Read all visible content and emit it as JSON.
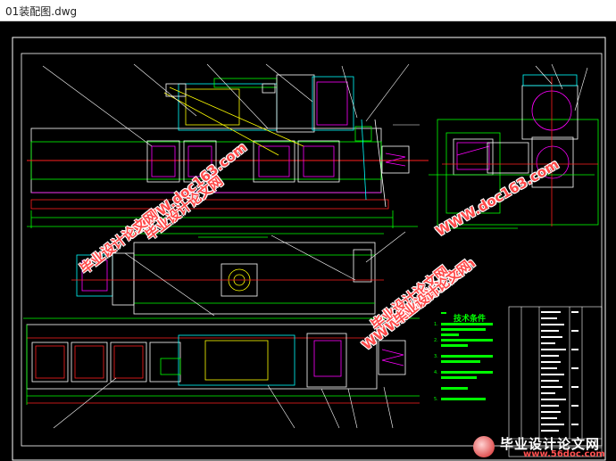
{
  "window": {
    "title": "01装配图.dwg"
  },
  "watermarks": {
    "site1": "WWW.doc163.com",
    "site2": "毕业设计论文网",
    "site3": "毕业设计论文网",
    "site4": "WWW.doc163.com",
    "site5": "毕业设计论文网",
    "site6": "毕业设计论文网",
    "site7": "WWW.doc163.com"
  },
  "tech_requirements": {
    "heading": "技术条件",
    "notes": [
      "1.",
      "2.",
      "3.",
      "4.",
      "5."
    ]
  },
  "brand": {
    "name": "毕业设计论文网",
    "url": "www.56doc.com"
  },
  "colors": {
    "background": "#000000",
    "border": "#ffffff",
    "frame": "#ffffff",
    "red": "#ff2020",
    "green": "#00ff00",
    "cyan": "#00ffff",
    "yellow": "#ffff00",
    "magenta": "#ff00ff",
    "watermark": "#ff4a4a"
  }
}
